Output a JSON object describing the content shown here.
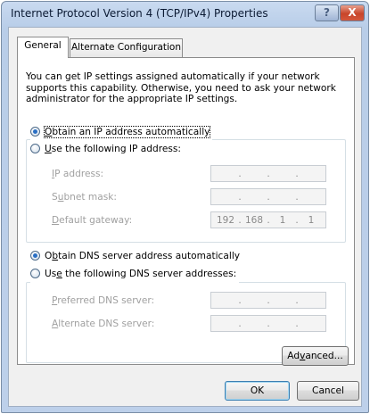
{
  "window": {
    "title": "Internet Protocol Version 4 (TCP/IPv4) Properties",
    "help_label": "?",
    "close_label": "X"
  },
  "tabs": [
    {
      "label": "General",
      "active": true
    },
    {
      "label": "Alternate Configuration",
      "active": false
    }
  ],
  "description": "You can get IP settings assigned automatically if your network supports this capability. Otherwise, you need to ask your network administrator for the appropriate IP settings.",
  "ip_settings": {
    "auto_option": {
      "pre": "",
      "access": "O",
      "post": "btain an IP address automatically",
      "checked": true
    },
    "manual_option": {
      "pre": "",
      "access": "U",
      "post": "se the following IP address:",
      "checked": false
    },
    "fields": [
      {
        "pre": "",
        "access": "I",
        "post": "P address:",
        "value": [
          "",
          "",
          "",
          ""
        ]
      },
      {
        "pre": "S",
        "access": "u",
        "post": "bnet mask:",
        "value": [
          "",
          "",
          "",
          ""
        ]
      },
      {
        "pre": "",
        "access": "D",
        "post": "efault gateway:",
        "value": [
          "192",
          "168",
          "1",
          "1"
        ]
      }
    ]
  },
  "dns_settings": {
    "auto_option": {
      "pre": "O",
      "access": "b",
      "post": "tain DNS server address automatically",
      "checked": true
    },
    "manual_option": {
      "pre": "Us",
      "access": "e",
      "post": " the following DNS server addresses:",
      "checked": false
    },
    "fields": [
      {
        "pre": "",
        "access": "P",
        "post": "referred DNS server:",
        "value": [
          "",
          "",
          "",
          ""
        ]
      },
      {
        "pre": "",
        "access": "A",
        "post": "lternate DNS server:",
        "value": [
          "",
          "",
          "",
          ""
        ]
      }
    ]
  },
  "buttons": {
    "advanced": {
      "pre": "Ad",
      "access": "v",
      "post": "anced..."
    },
    "ok": "OK",
    "cancel": "Cancel"
  },
  "colors": {
    "title_gradient": "#bdd0ea",
    "close_button": "#c8452a",
    "disabled_text": "#a0a0a0",
    "radio_dot": "#2a6fc4"
  }
}
